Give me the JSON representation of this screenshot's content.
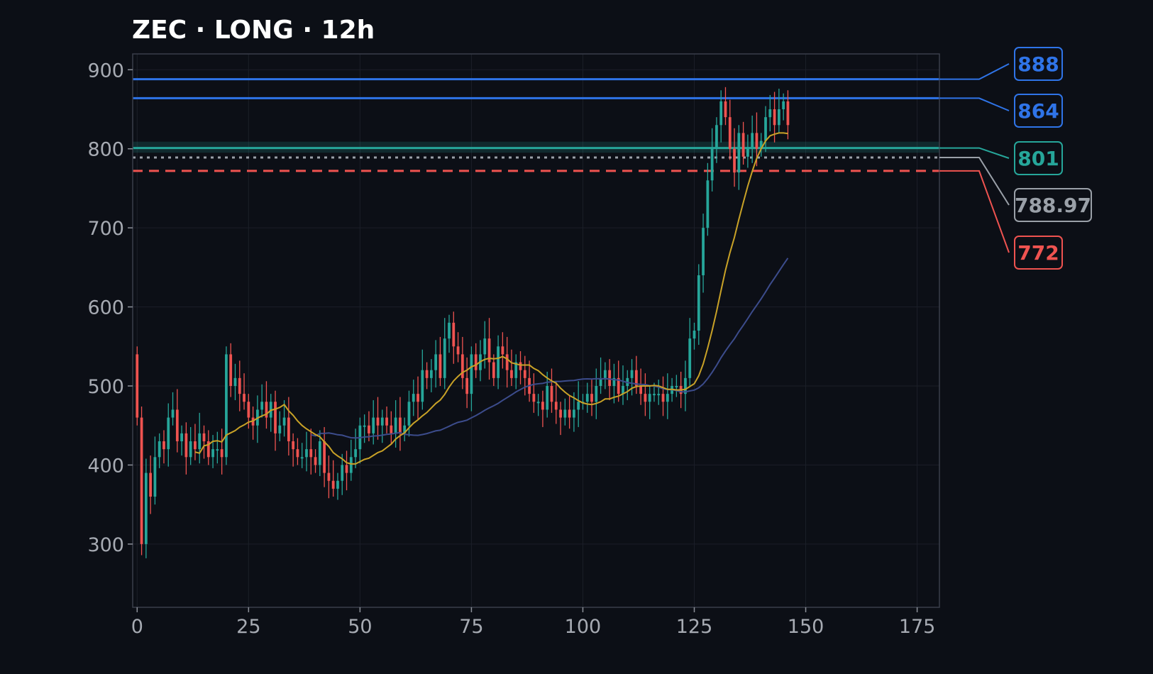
{
  "chart_data": {
    "type": "candlestick",
    "title": "ZEC · LONG · 12h",
    "xlim": [
      -1,
      180
    ],
    "ylim": [
      220,
      920
    ],
    "x_ticks": [
      0,
      25,
      50,
      75,
      100,
      125,
      150,
      175
    ],
    "y_ticks": [
      300,
      400,
      500,
      600,
      700,
      800,
      900
    ],
    "grid": true,
    "colors": {
      "up": "#26a69a",
      "down": "#ef5350",
      "ma_fast": "#c9a227",
      "ma_slow": "#3c4c8c",
      "blue": "#2f74e8",
      "teal": "#26a69a",
      "gray": "#9aa0a8",
      "red": "#ef5350"
    },
    "closes": [
      460,
      300,
      390,
      360,
      410,
      430,
      420,
      460,
      470,
      430,
      440,
      410,
      430,
      420,
      440,
      430,
      410,
      420,
      420,
      410,
      540,
      500,
      510,
      490,
      480,
      460,
      450,
      470,
      480,
      460,
      480,
      440,
      450,
      460,
      430,
      420,
      410,
      410,
      420,
      410,
      400,
      430,
      390,
      380,
      370,
      380,
      400,
      390,
      410,
      420,
      450,
      450,
      440,
      460,
      450,
      460,
      450,
      440,
      460,
      440,
      450,
      480,
      490,
      480,
      520,
      510,
      520,
      540,
      510,
      560,
      580,
      550,
      540,
      510,
      490,
      540,
      520,
      540,
      560,
      530,
      510,
      550,
      540,
      520,
      510,
      530,
      520,
      510,
      490,
      480,
      480,
      470,
      500,
      480,
      470,
      460,
      470,
      460,
      470,
      480,
      480,
      490,
      480,
      500,
      510,
      520,
      500,
      510,
      490,
      500,
      510,
      520,
      500,
      490,
      480,
      490,
      490,
      490,
      480,
      490,
      500,
      500,
      490,
      510,
      560,
      570,
      640,
      700,
      760,
      800,
      830,
      860,
      840,
      800,
      770,
      820,
      790,
      800,
      820,
      800,
      810,
      840,
      850,
      830,
      850,
      860,
      830
    ],
    "closes_start_index": 0,
    "levels": [
      {
        "label": "888",
        "value": 888,
        "style": "solid",
        "color": "#2f74e8"
      },
      {
        "label": "864",
        "value": 864,
        "style": "solid",
        "color": "#2f74e8"
      },
      {
        "label": "801",
        "value": 801,
        "style": "solid",
        "color": "#26a69a"
      },
      {
        "label": "788.97",
        "value": 788.97,
        "style": "dotted",
        "color": "#9aa0a8"
      },
      {
        "label": "772",
        "value": 772,
        "style": "dashed",
        "color": "#ef5350"
      }
    ]
  }
}
